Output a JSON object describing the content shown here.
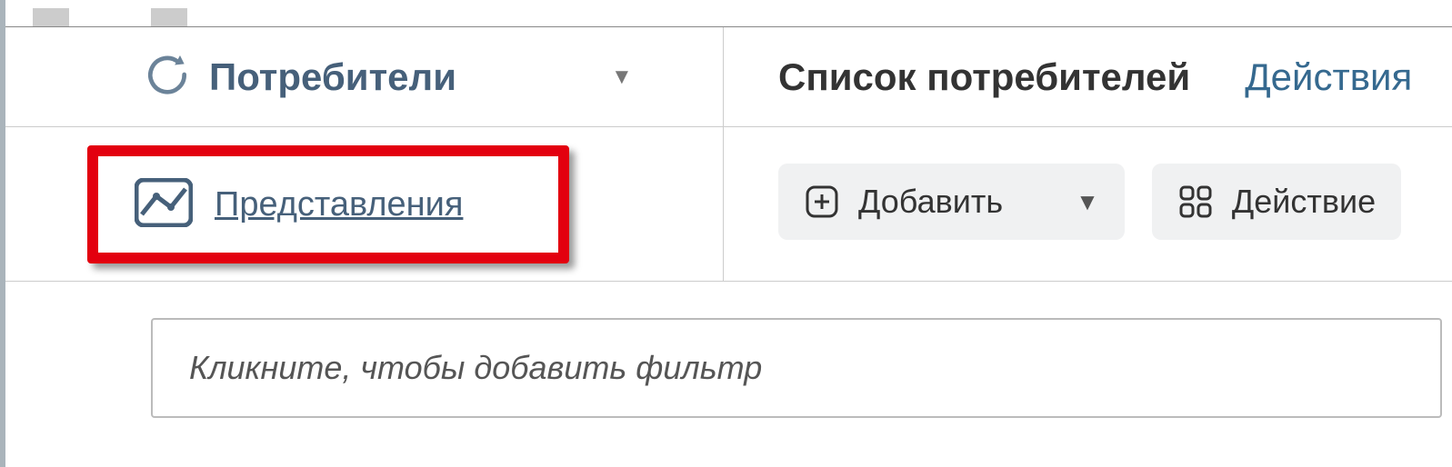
{
  "header": {
    "section_title": "Потребители",
    "list_title": "Список потребителей",
    "actions_label": "Действия"
  },
  "sidebar": {
    "views_link": "Представления"
  },
  "toolbar": {
    "add_label": "Добавить",
    "action_label": "Действие"
  },
  "filter": {
    "placeholder": "Кликните, чтобы добавить фильтр"
  }
}
